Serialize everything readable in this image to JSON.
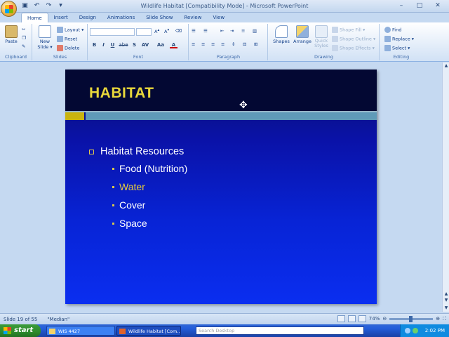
{
  "window": {
    "title": "Wildlife Habitat [Compatibility Mode] - Microsoft PowerPoint",
    "controls": [
      "–",
      "□",
      "✕"
    ]
  },
  "qat": [
    "save",
    "undo",
    "redo",
    "customize"
  ],
  "tabs": [
    {
      "label": "Home",
      "active": true
    },
    {
      "label": "Insert"
    },
    {
      "label": "Design"
    },
    {
      "label": "Animations"
    },
    {
      "label": "Slide Show"
    },
    {
      "label": "Review"
    },
    {
      "label": "View"
    }
  ],
  "ribbon": {
    "clipboard": {
      "label": "Clipboard",
      "paste": "Paste"
    },
    "slides": {
      "label": "Slides",
      "new_slide": "New Slide ▾",
      "layout": "Layout ▾",
      "reset": "Reset",
      "delete": "Delete"
    },
    "font": {
      "label": "Font",
      "bold": "B",
      "italic": "I",
      "underline": "U",
      "strike": "abe",
      "shadow": "S",
      "spacing": "AV",
      "case": "Aa",
      "color": "A"
    },
    "paragraph": {
      "label": "Paragraph"
    },
    "drawing": {
      "label": "Drawing",
      "shapes": "Shapes",
      "arrange": "Arrange",
      "quick_styles": "Quick Styles",
      "shape_fill": "Shape Fill ▾",
      "shape_outline": "Shape Outline ▾",
      "shape_effects": "Shape Effects ▾"
    },
    "editing": {
      "label": "Editing",
      "find": "Find",
      "replace": "Replace ▾",
      "select": "Select ▾"
    }
  },
  "slide": {
    "title": "HABITAT",
    "bullet_main": "Habitat Resources",
    "sub_bullets": [
      "Food (Nutrition)",
      "Water",
      "Cover",
      "Space"
    ]
  },
  "status": {
    "slide_info": "Slide 19 of 55",
    "theme": "\"Median\"",
    "zoom": "74%"
  },
  "taskbar": {
    "start": "start",
    "tasks": [
      "WIS 4427",
      "Wildlife Habitat [Com..."
    ],
    "search_placeholder": "Search Desktop",
    "clock": "2:02 PM"
  },
  "colors": {
    "slide_title": "#e8d73b",
    "slide_bg_top": "#030833",
    "slide_bg": "#0a2ef0",
    "accent_teal": "#5f9ab8",
    "accent_yellow": "#c9b30f",
    "highlight_bullet": "#e6cc3a"
  }
}
